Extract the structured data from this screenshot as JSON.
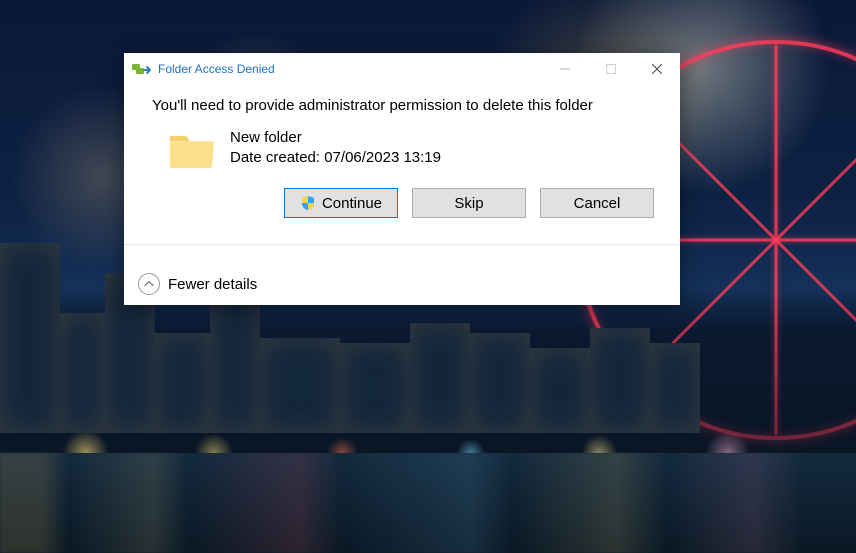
{
  "dialog": {
    "title": "Folder Access Denied",
    "message": "You'll need to provide administrator permission to delete this folder",
    "item": {
      "name": "New folder",
      "date_line": "Date created: 07/06/2023 13:19"
    },
    "buttons": {
      "continue": "Continue",
      "skip": "Skip",
      "cancel": "Cancel"
    },
    "footer": {
      "toggle": "Fewer details"
    }
  }
}
